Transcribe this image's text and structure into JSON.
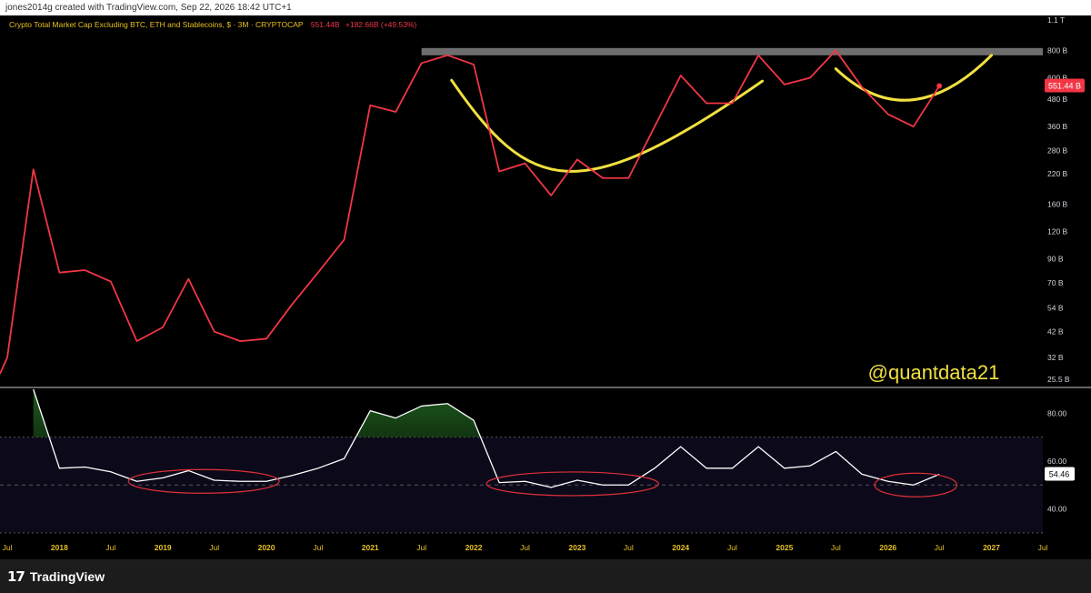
{
  "header": {
    "credit": "jones2014g created with TradingView.com, Sep 22, 2026 18:42 UTC+1"
  },
  "footer": {
    "brand": "TradingView",
    "logo_mark": "17"
  },
  "colors": {
    "price_line": "#f23645",
    "rsi_line": "#ffffff",
    "curve": "#f0e040",
    "resistance_band": "#6e6e6e",
    "ellipse": "#e0303a",
    "overbought_fill": "#1e5a1e",
    "rsi_band": "#0c0a1a",
    "axis_text": "#d1d4dc",
    "date_text": "#e8c020"
  },
  "watermark": "@quantdata21",
  "chart_data": [
    {
      "type": "line",
      "title": "Crypto Total Market Cap Excluding BTC, ETH and Stablecoins, $ · 3M · CRYPTOCAP",
      "title_value": "551.44B",
      "title_change": "+182.66B (+49.53%)",
      "log_scale": true,
      "ylim": [
        25.5,
        1100
      ],
      "ytick_labels": [
        "1.1 T",
        "800 B",
        "600 B",
        "480 B",
        "360 B",
        "280 B",
        "220 B",
        "160 B",
        "120 B",
        "90 B",
        "70 B",
        "54 B",
        "42 B",
        "32 B",
        "25.5 B"
      ],
      "ytick_values": [
        1100,
        800,
        600,
        480,
        360,
        280,
        220,
        160,
        120,
        90,
        70,
        54,
        42,
        32,
        25.5
      ],
      "last_value_label": "551.44 B",
      "x_labels": [
        "Jul",
        "2018",
        "Jul",
        "2019",
        "Jul",
        "2020",
        "Jul",
        "2021",
        "Jul",
        "2022",
        "Jul",
        "2023",
        "Jul",
        "2024",
        "Jul",
        "2025",
        "Jul",
        "2026",
        "Jul",
        "2027",
        "Jul"
      ],
      "x_start": "2017-07-01",
      "x_end": "2027-07-01",
      "series": [
        {
          "dates": [
            "2017-07-01",
            "2017-10-01",
            "2018-01-01",
            "2018-04-01",
            "2018-07-01",
            "2018-10-01",
            "2019-01-01",
            "2019-04-01",
            "2019-07-01",
            "2019-10-01",
            "2020-01-01",
            "2020-04-01",
            "2020-07-01",
            "2020-10-01",
            "2021-01-01",
            "2021-04-01",
            "2021-07-01",
            "2021-10-01",
            "2022-01-01",
            "2022-04-01",
            "2022-07-01",
            "2022-10-01",
            "2023-01-01",
            "2023-04-01",
            "2023-07-01",
            "2023-10-01",
            "2024-01-01",
            "2024-04-01",
            "2024-07-01",
            "2024-10-01",
            "2025-01-01",
            "2025-04-01",
            "2025-07-01",
            "2025-10-01",
            "2026-01-01",
            "2026-04-01",
            "2026-07-01"
          ],
          "values": [
            27,
            32,
            230,
            78,
            80,
            71,
            38,
            44,
            73,
            42,
            38,
            39,
            56,
            78,
            110,
            450,
            420,
            700,
            760,
            690,
            225,
            245,
            175,
            255,
            210,
            210,
            360,
            615,
            460,
            460,
            760,
            560,
            600,
            800,
            545,
            410,
            360,
            551.44
          ]
        }
      ],
      "resistance_band": [
        760,
        820
      ],
      "annotations": [
        {
          "type": "curve",
          "dates": [
            "2021-10-15",
            "2022-07-15",
            "2023-01-01",
            "2024-10-15"
          ],
          "values": [
            585,
            180,
            150,
            580
          ]
        },
        {
          "type": "curve",
          "dates": [
            "2025-07-01",
            "2026-03-15",
            "2027-01-01"
          ],
          "values": [
            660,
            320,
            760
          ]
        }
      ]
    },
    {
      "type": "line",
      "title": "",
      "ylim": [
        25,
        90
      ],
      "ytick_labels": [
        "80.00",
        "60.00",
        "40.00"
      ],
      "ytick_values": [
        80,
        60,
        40
      ],
      "band": [
        30,
        70
      ],
      "midline": 50,
      "last_value_label": "54.46",
      "series": [
        {
          "dates": [
            "2017-10-01",
            "2018-01-01",
            "2018-04-01",
            "2018-07-01",
            "2018-10-01",
            "2019-01-01",
            "2019-04-01",
            "2019-07-01",
            "2019-10-01",
            "2020-01-01",
            "2020-04-01",
            "2020-07-01",
            "2020-10-01",
            "2021-01-01",
            "2021-04-01",
            "2021-07-01",
            "2021-10-01",
            "2022-01-01",
            "2022-04-01",
            "2022-07-01",
            "2022-10-01",
            "2023-01-01",
            "2023-04-01",
            "2023-07-01",
            "2023-10-01",
            "2024-01-01",
            "2024-04-01",
            "2024-07-01",
            "2024-10-01",
            "2025-01-01",
            "2025-04-01",
            "2025-07-01",
            "2025-10-01",
            "2026-01-01",
            "2026-04-01",
            "2026-07-01"
          ],
          "values": [
            90,
            57,
            57.5,
            55.5,
            51.5,
            53,
            56,
            52,
            51.5,
            51.5,
            54,
            57,
            61,
            81,
            78,
            83,
            84,
            77,
            51,
            51.5,
            49,
            52,
            50,
            50,
            57,
            66,
            57,
            57,
            66,
            57,
            58,
            64,
            54.5,
            51.5,
            50,
            54.46
          ]
        }
      ],
      "ellipses": [
        {
          "dates": [
            "2018-09-01",
            "2020-02-15"
          ],
          "center": 51.5
        },
        {
          "dates": [
            "2022-02-15",
            "2023-10-15"
          ],
          "center": 50.5
        },
        {
          "dates": [
            "2025-11-15",
            "2026-09-01"
          ],
          "center": 50
        }
      ]
    }
  ]
}
